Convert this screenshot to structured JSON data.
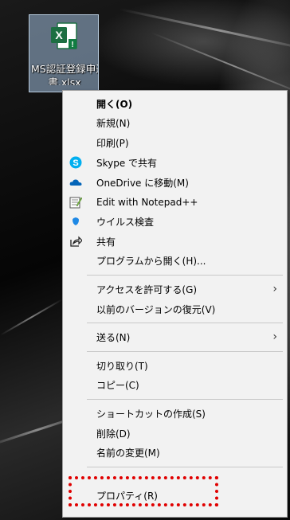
{
  "desktop": {
    "file_icon": {
      "icon": "excel-file-icon",
      "label_line1": "MS認証登録申込",
      "label_line2": "書.xlsx"
    }
  },
  "menu": {
    "items": [
      {
        "label": "開く(O)",
        "icon": "",
        "bold": true
      },
      {
        "label": "新規(N)",
        "icon": ""
      },
      {
        "label": "印刷(P)",
        "icon": ""
      },
      {
        "label": "Skype で共有",
        "icon": "skype-icon"
      },
      {
        "label": "OneDrive に移動(M)",
        "icon": "onedrive-icon"
      },
      {
        "label": "Edit with Notepad++",
        "icon": "notepadpp-icon"
      },
      {
        "label": "ウイルス検査",
        "icon": "shield-icon"
      },
      {
        "label": "共有",
        "icon": "share-icon"
      },
      {
        "label": "プログラムから開く(H)...",
        "icon": ""
      },
      {
        "label": "アクセスを許可する(G)",
        "icon": "",
        "submenu": true
      },
      {
        "label": "以前のバージョンの復元(V)",
        "icon": ""
      },
      {
        "label": "送る(N)",
        "icon": "",
        "submenu": true
      },
      {
        "label": "切り取り(T)",
        "icon": ""
      },
      {
        "label": "コピー(C)",
        "icon": ""
      },
      {
        "label": "ショートカットの作成(S)",
        "icon": ""
      },
      {
        "label": "削除(D)",
        "icon": ""
      },
      {
        "label": "名前の変更(M)",
        "icon": ""
      },
      {
        "label": "プロパティ(R)",
        "icon": "",
        "highlighted": true
      }
    ],
    "submenu_glyph": "›"
  },
  "colors": {
    "highlight": "#e00000",
    "skype": "#00aff0",
    "onedrive": "#0364b8",
    "excel": "#1d6f42"
  }
}
